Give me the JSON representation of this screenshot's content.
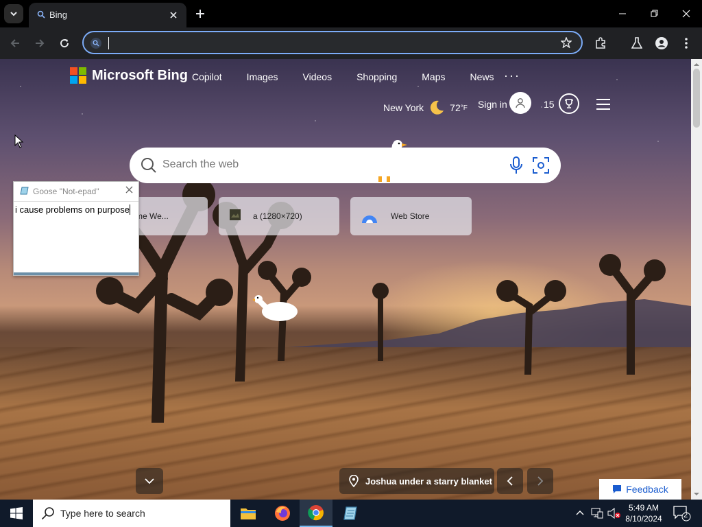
{
  "browser": {
    "tab_title": "Bing",
    "address_value": "",
    "new_tab_symbol": "+"
  },
  "bing": {
    "logo_text": "Microsoft Bing",
    "nav": [
      "Copilot",
      "Images",
      "Videos",
      "Shopping",
      "Maps",
      "News"
    ],
    "more_symbol": "···",
    "weather_city": "New York",
    "weather_temp": "72",
    "weather_unit": "°F",
    "signin_label": "Sign in",
    "rewards_points": "15",
    "search_placeholder": "Search the web",
    "tiles": [
      {
        "label": "me We..."
      },
      {
        "label": "a (1280×720)"
      },
      {
        "label": "Web Store"
      }
    ],
    "caption": "Joshua under a starry blanket",
    "feedback_label": "Feedback"
  },
  "notepad": {
    "title": "Goose \"Not-epad\"",
    "text": "i cause problems on purpose"
  },
  "taskbar": {
    "search_placeholder": "Type here to search",
    "time": "5:49 AM",
    "date": "8/10/2024",
    "notification_count": "2"
  },
  "colors": {
    "accent_blue": "#7cacf8",
    "taskbar_bg": "#101a2a",
    "ms_red": "#f25022",
    "ms_green": "#7fba00",
    "ms_blue": "#00a4ef",
    "ms_yellow": "#ffb900"
  }
}
